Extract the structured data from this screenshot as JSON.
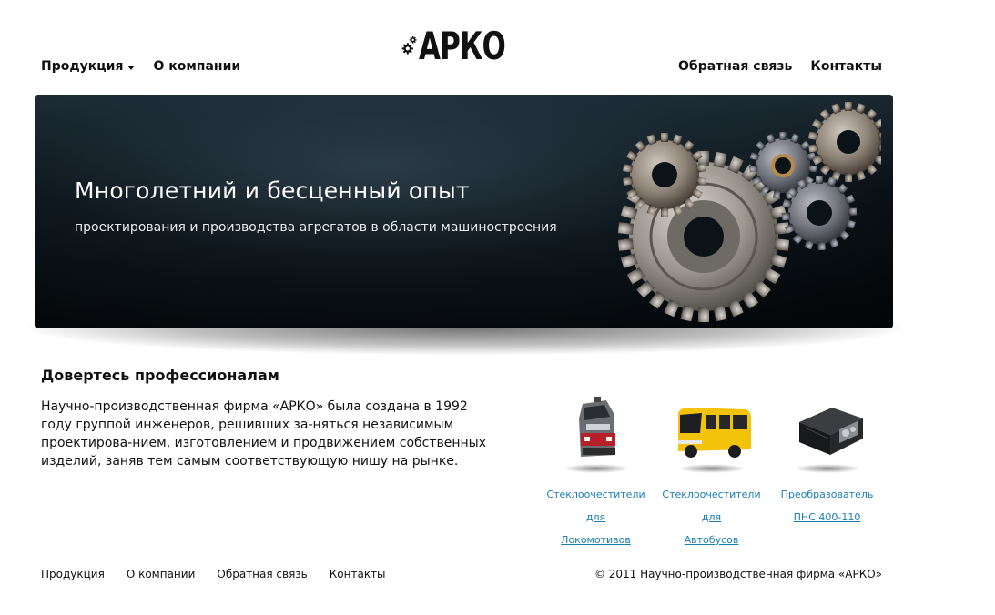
{
  "header": {
    "nav_left": [
      {
        "label": "Продукция",
        "has_dropdown": true
      },
      {
        "label": "О компании"
      }
    ],
    "nav_right": [
      {
        "label": "Обратная связь"
      },
      {
        "label": "Контакты"
      }
    ],
    "logo_text": "АРКО"
  },
  "banner": {
    "title": "Многолетний и бесценный опыт",
    "subtitle": "проектирования и производства агрегатов в области машиностроения"
  },
  "content": {
    "title": "Довертесь профессионалам",
    "text": "Научно-производственная фирма «АРКО» была создана в 1992 году группой инженеров, решивших за-няться независимым проектирова-нием, изготовлением и продвижением собственных изделий, заняв тем самым соответствующую нишу на рынке."
  },
  "products": [
    {
      "line1": "Стеклоочестители для",
      "line2": "Локомотивов",
      "icon": "locomotive-icon"
    },
    {
      "line1": "Стеклоочестители для",
      "line2": "Автобусов",
      "icon": "bus-icon"
    },
    {
      "line1": "Преобразователь",
      "line2": "ПНС 400-110",
      "icon": "converter-icon"
    }
  ],
  "footer": {
    "nav": [
      "Продукция",
      "О компании",
      "Обратная связь",
      "Контакты"
    ],
    "copyright": "© 2011 Научно-производственная фирма «АРКО»"
  },
  "colors": {
    "link": "#1a7fb0",
    "text": "#111111",
    "banner_bg": "#0b1318"
  }
}
